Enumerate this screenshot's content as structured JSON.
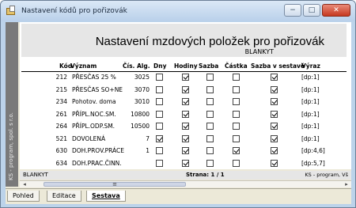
{
  "window": {
    "title": "Nastavení kódů pro pořizovák",
    "minimize": "−",
    "maximize": "□",
    "close": "✕"
  },
  "side_text": "KS - program, spol. s r.o.",
  "report": {
    "title": "Nastavení mzdových položek pro pořizovák",
    "subtitle": "BLANKYT",
    "columns": {
      "kod": "Kód",
      "vyznam": "Význam",
      "cis_alg": "Čís. Alg.",
      "dny": "Dny",
      "hodiny": "Hodiny",
      "sazba": "Sazba",
      "castka": "Částka",
      "sazba_v_sestave": "Sazba v sestavě",
      "vyraz": "Výraz"
    },
    "rows": [
      {
        "kod": "212",
        "vyznam": "PŘESČAS 25 %",
        "alg": "3025",
        "dny": false,
        "hodiny": true,
        "sazba": false,
        "castka": false,
        "sazba_v_sestave": true,
        "vyraz": "[dp:1]"
      },
      {
        "kod": "215",
        "vyznam": "PŘESČAS SO+NE",
        "alg": "3070",
        "dny": false,
        "hodiny": true,
        "sazba": false,
        "castka": false,
        "sazba_v_sestave": true,
        "vyraz": "[dp:1]"
      },
      {
        "kod": "234",
        "vyznam": "Pohotov. doma",
        "alg": "3010",
        "dny": false,
        "hodiny": true,
        "sazba": false,
        "castka": false,
        "sazba_v_sestave": true,
        "vyraz": "[dp:1]"
      },
      {
        "kod": "261",
        "vyznam": "PŘÍPL.NOC.SM.",
        "alg": "10800",
        "dny": false,
        "hodiny": true,
        "sazba": false,
        "castka": false,
        "sazba_v_sestave": true,
        "vyraz": "[dp:1]"
      },
      {
        "kod": "264",
        "vyznam": "PŘÍPL.ODP.SM.",
        "alg": "10500",
        "dny": false,
        "hodiny": true,
        "sazba": false,
        "castka": false,
        "sazba_v_sestave": true,
        "vyraz": "[dp:1]"
      },
      {
        "kod": "521",
        "vyznam": "DOVOLENÁ",
        "alg": "7",
        "dny": true,
        "hodiny": true,
        "sazba": false,
        "castka": false,
        "sazba_v_sestave": true,
        "vyraz": "[dp:1]"
      },
      {
        "kod": "630",
        "vyznam": "DOH.PROV.PRÁCE",
        "alg": "1",
        "dny": false,
        "hodiny": true,
        "sazba": false,
        "castka": true,
        "sazba_v_sestave": true,
        "vyraz": "[dp:4,6]"
      },
      {
        "kod": "634",
        "vyznam": "DOH.PRAC.ČINN.",
        "alg": "",
        "dny": false,
        "hodiny": true,
        "sazba": false,
        "castka": false,
        "sazba_v_sestave": true,
        "vyraz": "[dp:5,7]"
      }
    ]
  },
  "footer": {
    "left": "BLANKYT",
    "page": "Strana: 1 / 1",
    "right": "KS - program, Vš"
  },
  "scroll": {
    "left_arrow": "◂",
    "right_arrow": "▸",
    "grip": "≡"
  },
  "tabs": [
    {
      "label": "Pohled",
      "active": false
    },
    {
      "label": "Editace",
      "active": false
    },
    {
      "label": "Sestava",
      "active": true
    }
  ]
}
